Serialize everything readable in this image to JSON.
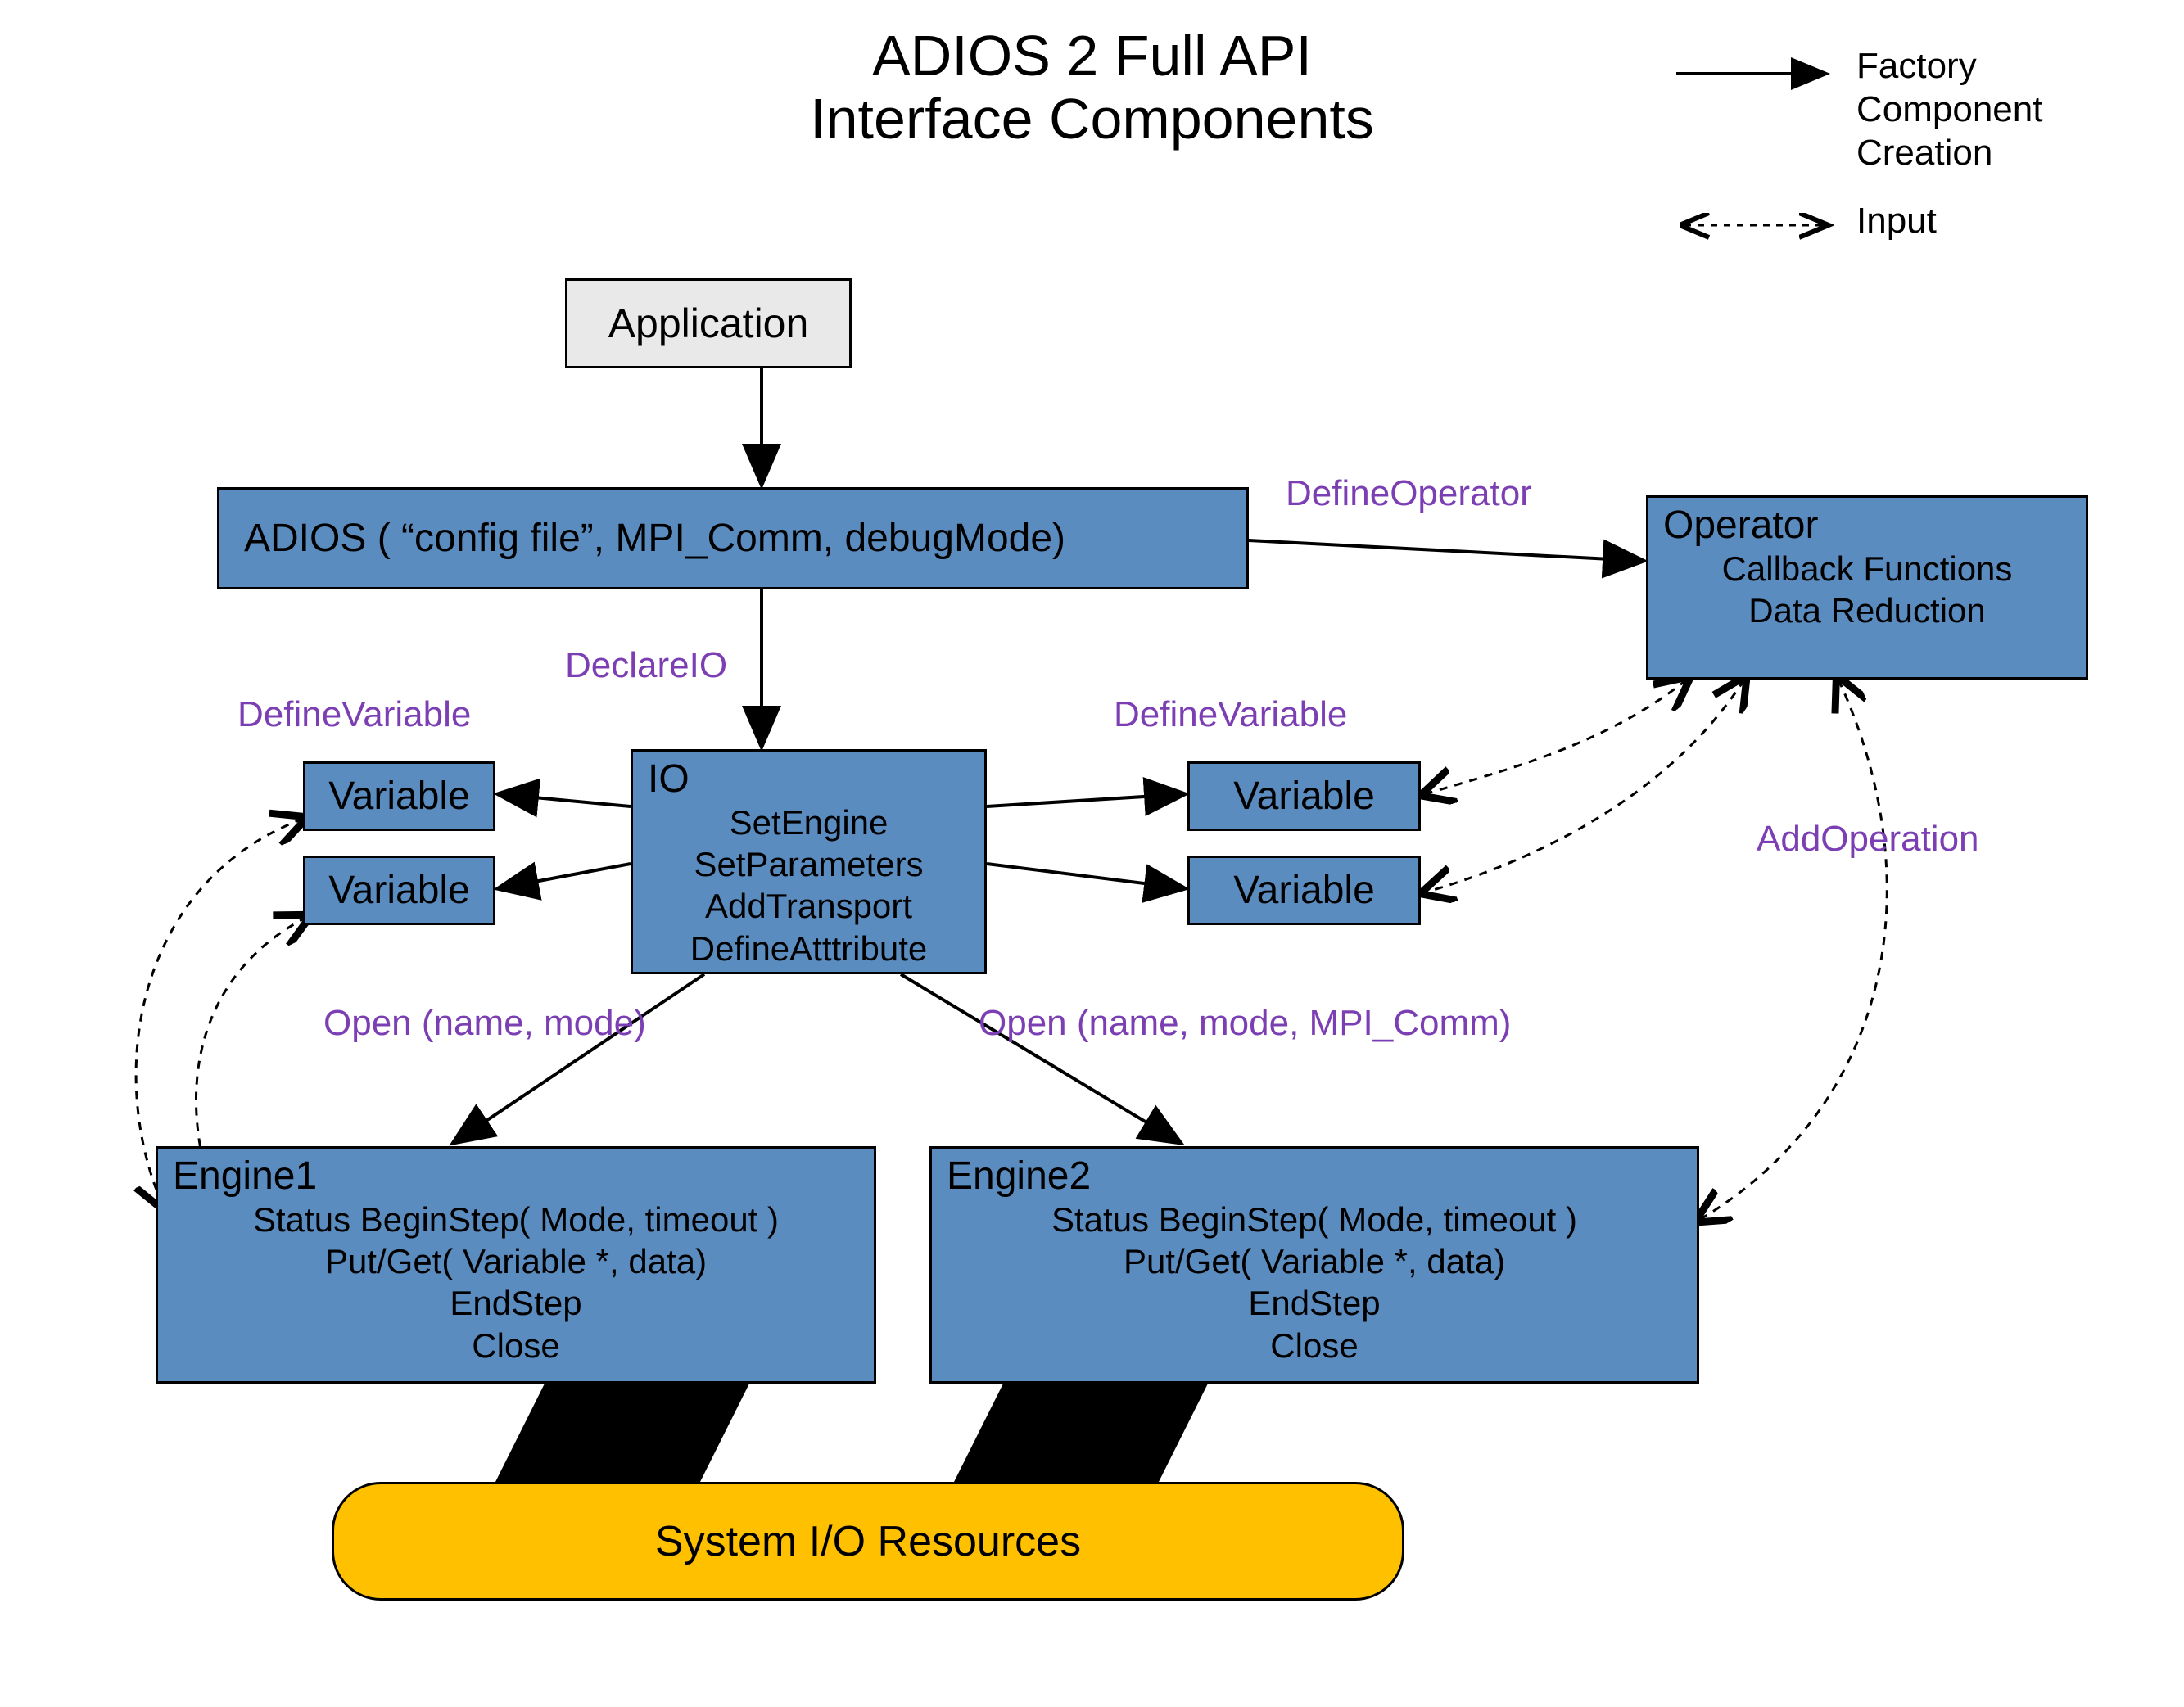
{
  "title": {
    "line1": "ADIOS 2 Full API",
    "line2": "Interface Components"
  },
  "legend": {
    "factory": "Factory\nComponent\nCreation",
    "input": "Input"
  },
  "nodes": {
    "application": "Application",
    "adios": "ADIOS ( “config file”, MPI_Comm, debugMode)",
    "operator": {
      "header": "Operator",
      "lines": [
        "Callback Functions",
        "Data Reduction"
      ]
    },
    "io": {
      "header": "IO",
      "lines": [
        "SetEngine",
        "SetParameters",
        "AddTransport",
        "DefineAtttribute"
      ]
    },
    "variable": "Variable",
    "engine1": {
      "header": "Engine1",
      "lines": [
        "Status BeginStep( Mode, timeout )",
        "Put/Get( Variable *, data)",
        "EndStep",
        "Close"
      ]
    },
    "engine2": {
      "header": "Engine2",
      "lines": [
        "Status BeginStep( Mode, timeout )",
        "Put/Get( Variable *, data)",
        "EndStep",
        "Close"
      ]
    },
    "resources": "System I/O Resources"
  },
  "edges": {
    "defineOperator": "DefineOperator",
    "declareIO": "DeclareIO",
    "defineVariable": "DefineVariable",
    "open1": "Open (name, mode)",
    "open2": "Open (name, mode, MPI_Comm)",
    "addOperation": "AddOperation"
  }
}
